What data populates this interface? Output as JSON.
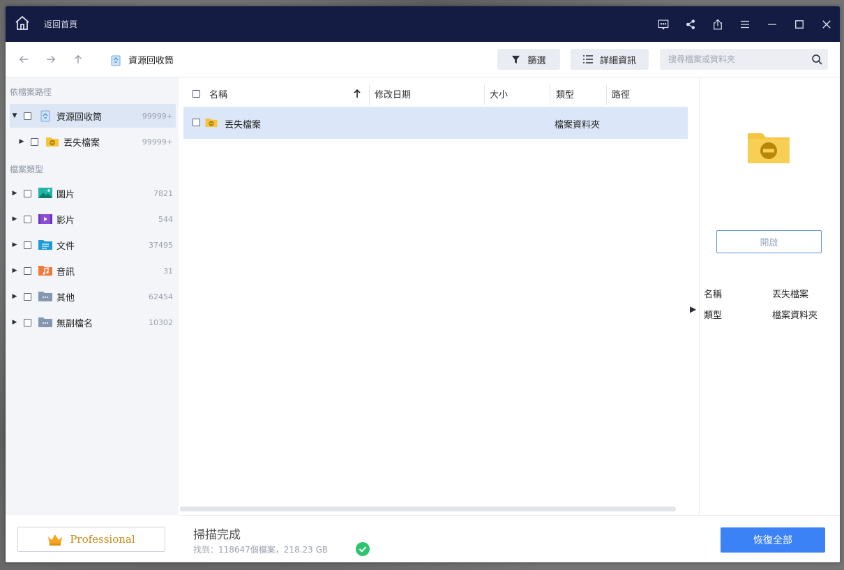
{
  "titlebar": {
    "back_home_label": "返回首頁",
    "icons": [
      "home-icon",
      "feedback-icon",
      "share-icon",
      "export-icon",
      "menu-icon",
      "minimize-icon",
      "maximize-icon",
      "close-icon"
    ]
  },
  "toolbar": {
    "breadcrumb_label": "資源回收筒",
    "filter_label": "篩選",
    "details_label": "詳細資訊",
    "search_placeholder": "搜尋檔案或資料夾"
  },
  "sidebar": {
    "path_heading": "依檔案路徑",
    "type_heading": "檔案類型",
    "path_items": [
      {
        "label": "資源回收筒",
        "count": "99999+",
        "icon": "recycle-bin-icon"
      },
      {
        "label": "丟失檔案",
        "count": "99999+",
        "icon": "lost-folder-icon"
      }
    ],
    "type_items": [
      {
        "label": "圖片",
        "count": "7821",
        "icon": "image-icon"
      },
      {
        "label": "影片",
        "count": "544",
        "icon": "video-icon"
      },
      {
        "label": "文件",
        "count": "37495",
        "icon": "document-icon"
      },
      {
        "label": "音訊",
        "count": "31",
        "icon": "audio-icon"
      },
      {
        "label": "其他",
        "count": "62454",
        "icon": "other-icon"
      },
      {
        "label": "無副檔名",
        "count": "10302",
        "icon": "no-extension-icon"
      }
    ],
    "pro_label": "Professional"
  },
  "table": {
    "columns": [
      "名稱",
      "修改日期",
      "大小",
      "類型",
      "路徑"
    ],
    "rows": [
      {
        "name": "丟失檔案",
        "modified": "",
        "size": "",
        "type": "檔案資料夾",
        "path": ""
      }
    ]
  },
  "detail": {
    "open_label": "開啟",
    "name_key": "名稱",
    "name_value": "丟失檔案",
    "type_key": "類型",
    "type_value": "檔案資料夾"
  },
  "status": {
    "title": "掃描完成",
    "found_text": "找到：118647個檔案，218.23 GB",
    "recover_all_label": "恢復全部"
  },
  "colors": {
    "titlebar": "#141c43",
    "accent": "#3b82f6",
    "selected_row": "#dbe7f8",
    "folder": "#f5c542",
    "success": "#2ec46d"
  }
}
